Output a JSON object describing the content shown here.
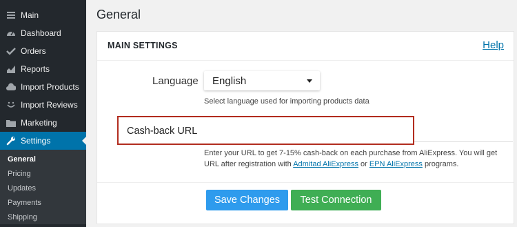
{
  "sidebar": {
    "items": [
      {
        "label": "Main",
        "icon": "menu-icon"
      },
      {
        "label": "Dashboard",
        "icon": "dashboard-icon"
      },
      {
        "label": "Orders",
        "icon": "checkmark-icon"
      },
      {
        "label": "Reports",
        "icon": "chart-icon"
      },
      {
        "label": "Import Products",
        "icon": "cloud-icon"
      },
      {
        "label": "Import Reviews",
        "icon": "smile-icon"
      },
      {
        "label": "Marketing",
        "icon": "folder-icon"
      },
      {
        "label": "Settings",
        "icon": "wrench-icon"
      }
    ],
    "submenu": [
      "General",
      "Pricing",
      "Updates",
      "Payments",
      "Shipping"
    ]
  },
  "page": {
    "title": "General"
  },
  "panel": {
    "title": "MAIN SETTINGS",
    "help": "Help",
    "language": {
      "label": "Language",
      "value": "English",
      "help": "Select language used for importing products data"
    },
    "cashback": {
      "label": "Cash-back URL",
      "help_part1": "Enter your URL to get 7-15% cash-back on each purchase from AliExpress. You will get URL after registration with ",
      "link1": "Admitad AliExpress",
      "help_or": " or ",
      "link2": "EPN AliExpress",
      "help_part2": " programs."
    },
    "buttons": {
      "save": "Save Changes",
      "test": "Test Connection"
    }
  },
  "colors": {
    "sidebar": "#23282d",
    "active": "#0073aa",
    "save": "#2e9bed",
    "test": "#3fae54",
    "highlight": "#b22c1e"
  }
}
